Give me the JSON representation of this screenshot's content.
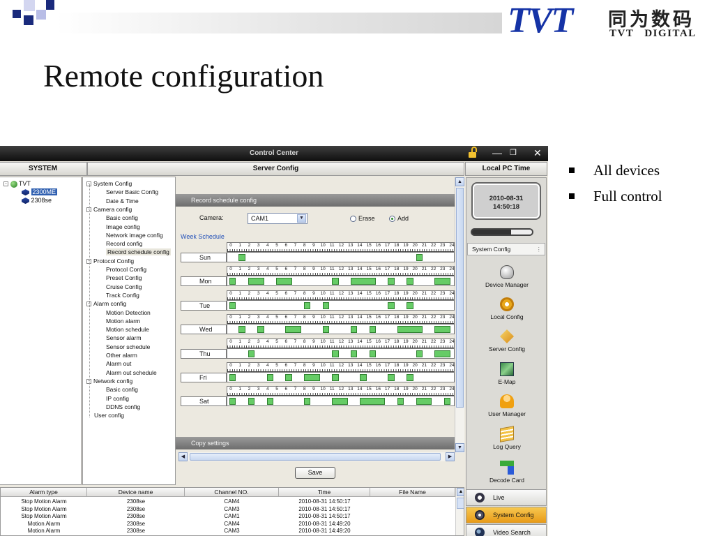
{
  "slide": {
    "title": "Remote configuration",
    "brand": {
      "logo": "TVT",
      "chinese": "同为数码",
      "english": "TVT DIGITAL"
    },
    "bullets": [
      "All devices",
      "Full control"
    ]
  },
  "window": {
    "title": "Control Center",
    "headers": {
      "left": "SYSTEM",
      "middle": "Server Config",
      "right": "Local PC Time"
    }
  },
  "device_tree": {
    "root": "TVT",
    "devices": [
      "2300ME",
      "2308se"
    ],
    "selected": "2300ME"
  },
  "config_tree": [
    {
      "label": "System Config",
      "level": 0,
      "expander": "-"
    },
    {
      "label": "Server Basic Config",
      "level": 1
    },
    {
      "label": "Date & Time",
      "level": 1
    },
    {
      "label": "Camera config",
      "level": 0,
      "expander": "-"
    },
    {
      "label": "Basic config",
      "level": 1
    },
    {
      "label": "Image config",
      "level": 1
    },
    {
      "label": "Network image config",
      "level": 1
    },
    {
      "label": "Record config",
      "level": 1
    },
    {
      "label": "Record schedule config",
      "level": 1,
      "selected": true
    },
    {
      "label": "Protocol Config",
      "level": 0,
      "expander": "-"
    },
    {
      "label": "Protocol Config",
      "level": 1
    },
    {
      "label": "Preset Config",
      "level": 1
    },
    {
      "label": "Cruise Config",
      "level": 1
    },
    {
      "label": "Track Config",
      "level": 1
    },
    {
      "label": "Alarm config",
      "level": 0,
      "expander": "-"
    },
    {
      "label": "Motion Detection",
      "level": 1
    },
    {
      "label": "Motion alarm",
      "level": 1
    },
    {
      "label": "Motion schedule",
      "level": 1
    },
    {
      "label": "Sensor alarm",
      "level": 1
    },
    {
      "label": "Sensor schedule",
      "level": 1
    },
    {
      "label": "Other alarm",
      "level": 1
    },
    {
      "label": "Alarm out",
      "level": 1
    },
    {
      "label": "Alarm out schedule",
      "level": 1
    },
    {
      "label": "Network config",
      "level": 0,
      "expander": "-"
    },
    {
      "label": "Basic config",
      "level": 1
    },
    {
      "label": "IP config",
      "level": 1
    },
    {
      "label": "DDNS config",
      "level": 1
    },
    {
      "label": "User config",
      "level": 0
    }
  ],
  "schedule": {
    "section_title": "Record schedule config",
    "camera_label": "Camera:",
    "camera_value": "CAM1",
    "erase_label": "Erase",
    "add_label": "Add",
    "mode_selected": "Add",
    "week_label": "Week Schedule",
    "copy_title": "Copy settings",
    "save_label": "Save",
    "hours": [
      "0",
      "1",
      "2",
      "3",
      "4",
      "5",
      "6",
      "7",
      "8",
      "9",
      "10",
      "11",
      "12",
      "13",
      "14",
      "15",
      "16",
      "17",
      "18",
      "19",
      "20",
      "21",
      "22",
      "23",
      "24"
    ],
    "days": [
      {
        "name": "Sun",
        "blocks": [
          [
            1,
            2
          ],
          [
            20,
            21
          ]
        ]
      },
      {
        "name": "Mon",
        "blocks": [
          [
            0,
            1
          ],
          [
            2,
            4
          ],
          [
            5,
            7
          ],
          [
            11,
            12
          ],
          [
            13,
            16
          ],
          [
            17,
            18
          ],
          [
            19,
            20
          ],
          [
            22,
            24
          ]
        ]
      },
      {
        "name": "Tue",
        "blocks": [
          [
            0,
            1
          ],
          [
            8,
            9
          ],
          [
            10,
            11
          ],
          [
            17,
            18
          ],
          [
            19,
            20
          ]
        ]
      },
      {
        "name": "Wed",
        "blocks": [
          [
            1,
            2
          ],
          [
            3,
            4
          ],
          [
            6,
            8
          ],
          [
            10,
            11
          ],
          [
            13,
            14
          ],
          [
            15,
            16
          ],
          [
            18,
            21
          ],
          [
            22,
            24
          ]
        ]
      },
      {
        "name": "Thu",
        "blocks": [
          [
            2,
            3
          ],
          [
            11,
            12
          ],
          [
            13,
            14
          ],
          [
            15,
            16
          ],
          [
            20,
            21
          ],
          [
            22,
            24
          ]
        ]
      },
      {
        "name": "Fri",
        "blocks": [
          [
            0,
            1
          ],
          [
            4,
            5
          ],
          [
            6,
            7
          ],
          [
            8,
            10
          ],
          [
            11,
            12
          ],
          [
            14,
            15
          ],
          [
            17,
            18
          ],
          [
            19,
            20
          ]
        ]
      },
      {
        "name": "Sat",
        "blocks": [
          [
            0,
            1
          ],
          [
            2,
            3
          ],
          [
            4,
            5
          ],
          [
            8,
            9
          ],
          [
            11,
            13
          ],
          [
            14,
            17
          ],
          [
            18,
            19
          ],
          [
            20,
            22
          ],
          [
            23,
            24
          ]
        ]
      }
    ]
  },
  "right_panel": {
    "date": "2010-08-31",
    "time": "14:50:18",
    "section": "System Config",
    "items": [
      "Device Manager",
      "Local Config",
      "Server Config",
      "E-Map",
      "User Manager",
      "Log Query",
      "Decode Card"
    ],
    "tabs": [
      {
        "label": "Live",
        "active": false
      },
      {
        "label": "System Config",
        "active": true
      },
      {
        "label": "Video Search",
        "active": false
      }
    ],
    "active_tab_color": "#f0b030"
  },
  "alarm_log": {
    "columns": [
      "Alarm type",
      "Device name",
      "Channel NO.",
      "Time",
      "File Name"
    ],
    "rows": [
      [
        "Stop Motion Alarm",
        "2308se",
        "CAM4",
        "2010-08-31 14:50:17",
        ""
      ],
      [
        "Stop Motion Alarm",
        "2308se",
        "CAM3",
        "2010-08-31 14:50:17",
        ""
      ],
      [
        "Stop Motion Alarm",
        "2308se",
        "CAM1",
        "2010-08-31 14:50:17",
        ""
      ],
      [
        "Motion Alarm",
        "2308se",
        "CAM4",
        "2010-08-31 14:49:20",
        ""
      ],
      [
        "Motion Alarm",
        "2308se",
        "CAM3",
        "2010-08-31 14:49:20",
        ""
      ]
    ]
  },
  "colors": {
    "brand_blue": "#1533a6",
    "deco_navy": "#1a2a7c",
    "deco_lavender": "#b8bde6",
    "schedule_green": "#66cc66"
  }
}
